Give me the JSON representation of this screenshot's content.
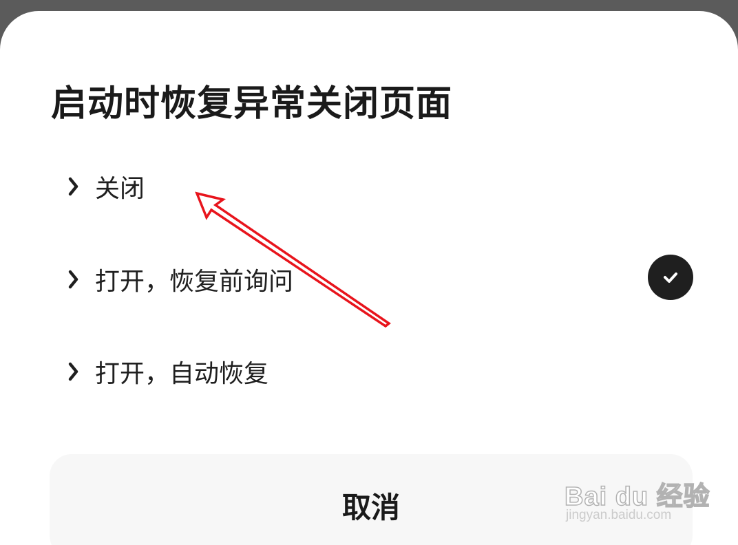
{
  "dialog": {
    "title": "启动时恢复异常关闭页面",
    "options": [
      {
        "label": "关闭",
        "selected": false
      },
      {
        "label": "打开，恢复前询问",
        "selected": true
      },
      {
        "label": "打开，自动恢复",
        "selected": false
      }
    ],
    "cancel_label": "取消"
  },
  "icons": {
    "option_prefix": "chevron-right-icon",
    "selected_marker": "check-circle-icon"
  },
  "annotation": {
    "arrow_color": "#e8141c"
  },
  "watermark": {
    "brand": "Bai du 经验",
    "site": "jingyan.baidu.com"
  }
}
